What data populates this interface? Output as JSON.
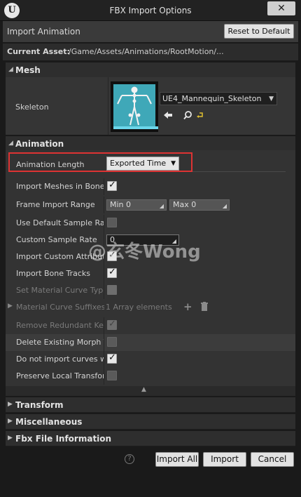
{
  "window": {
    "title": "FBX Import Options",
    "close_glyph": "✕",
    "logo_glyph": "U"
  },
  "header": {
    "label": "Import Animation",
    "reset_label": "Reset to Default",
    "asset_label": "Current Asset:",
    "asset_path": "/Game/Assets/Animations/RootMotion/..."
  },
  "mesh": {
    "title": "Mesh",
    "skeleton_label": "Skeleton",
    "skeleton_value": "UE4_Mannequin_Skeleton"
  },
  "animation": {
    "title": "Animation",
    "length_label": "Animation Length",
    "length_value": "Exported Time",
    "rows": {
      "import_meshes": "Import Meshes in Bone H",
      "frame_range": "Frame Import Range",
      "range_min_label": "Min",
      "range_min": "0",
      "range_max_label": "Max",
      "range_max": "0",
      "use_default_rate": "Use Default Sample Rate",
      "custom_rate": "Custom Sample Rate",
      "custom_rate_value": "0",
      "import_custom_attr": "Import Custom Attribute",
      "import_bone_tracks": "Import Bone Tracks",
      "set_material_curve": "Set Material Curve Type",
      "material_suffixes": "Material Curve Suffixes",
      "material_suffixes_value": "1 Array elements",
      "remove_redundant": "Remove Redundant Keys",
      "delete_morph": "Delete Existing Morph Ta",
      "do_not_import_curves": "Do not import curves wit",
      "preserve_local": "Preserve Local Transforr"
    }
  },
  "sections": {
    "transform": "Transform",
    "misc": "Miscellaneous",
    "fbx_info": "Fbx File Information"
  },
  "footer": {
    "import_all": "Import All",
    "import": "Import",
    "cancel": "Cancel",
    "help": "?"
  },
  "watermark": "@玄冬Wong",
  "colors": {
    "highlight": "#dd3333",
    "thumbnail": "#3fa8b8"
  }
}
